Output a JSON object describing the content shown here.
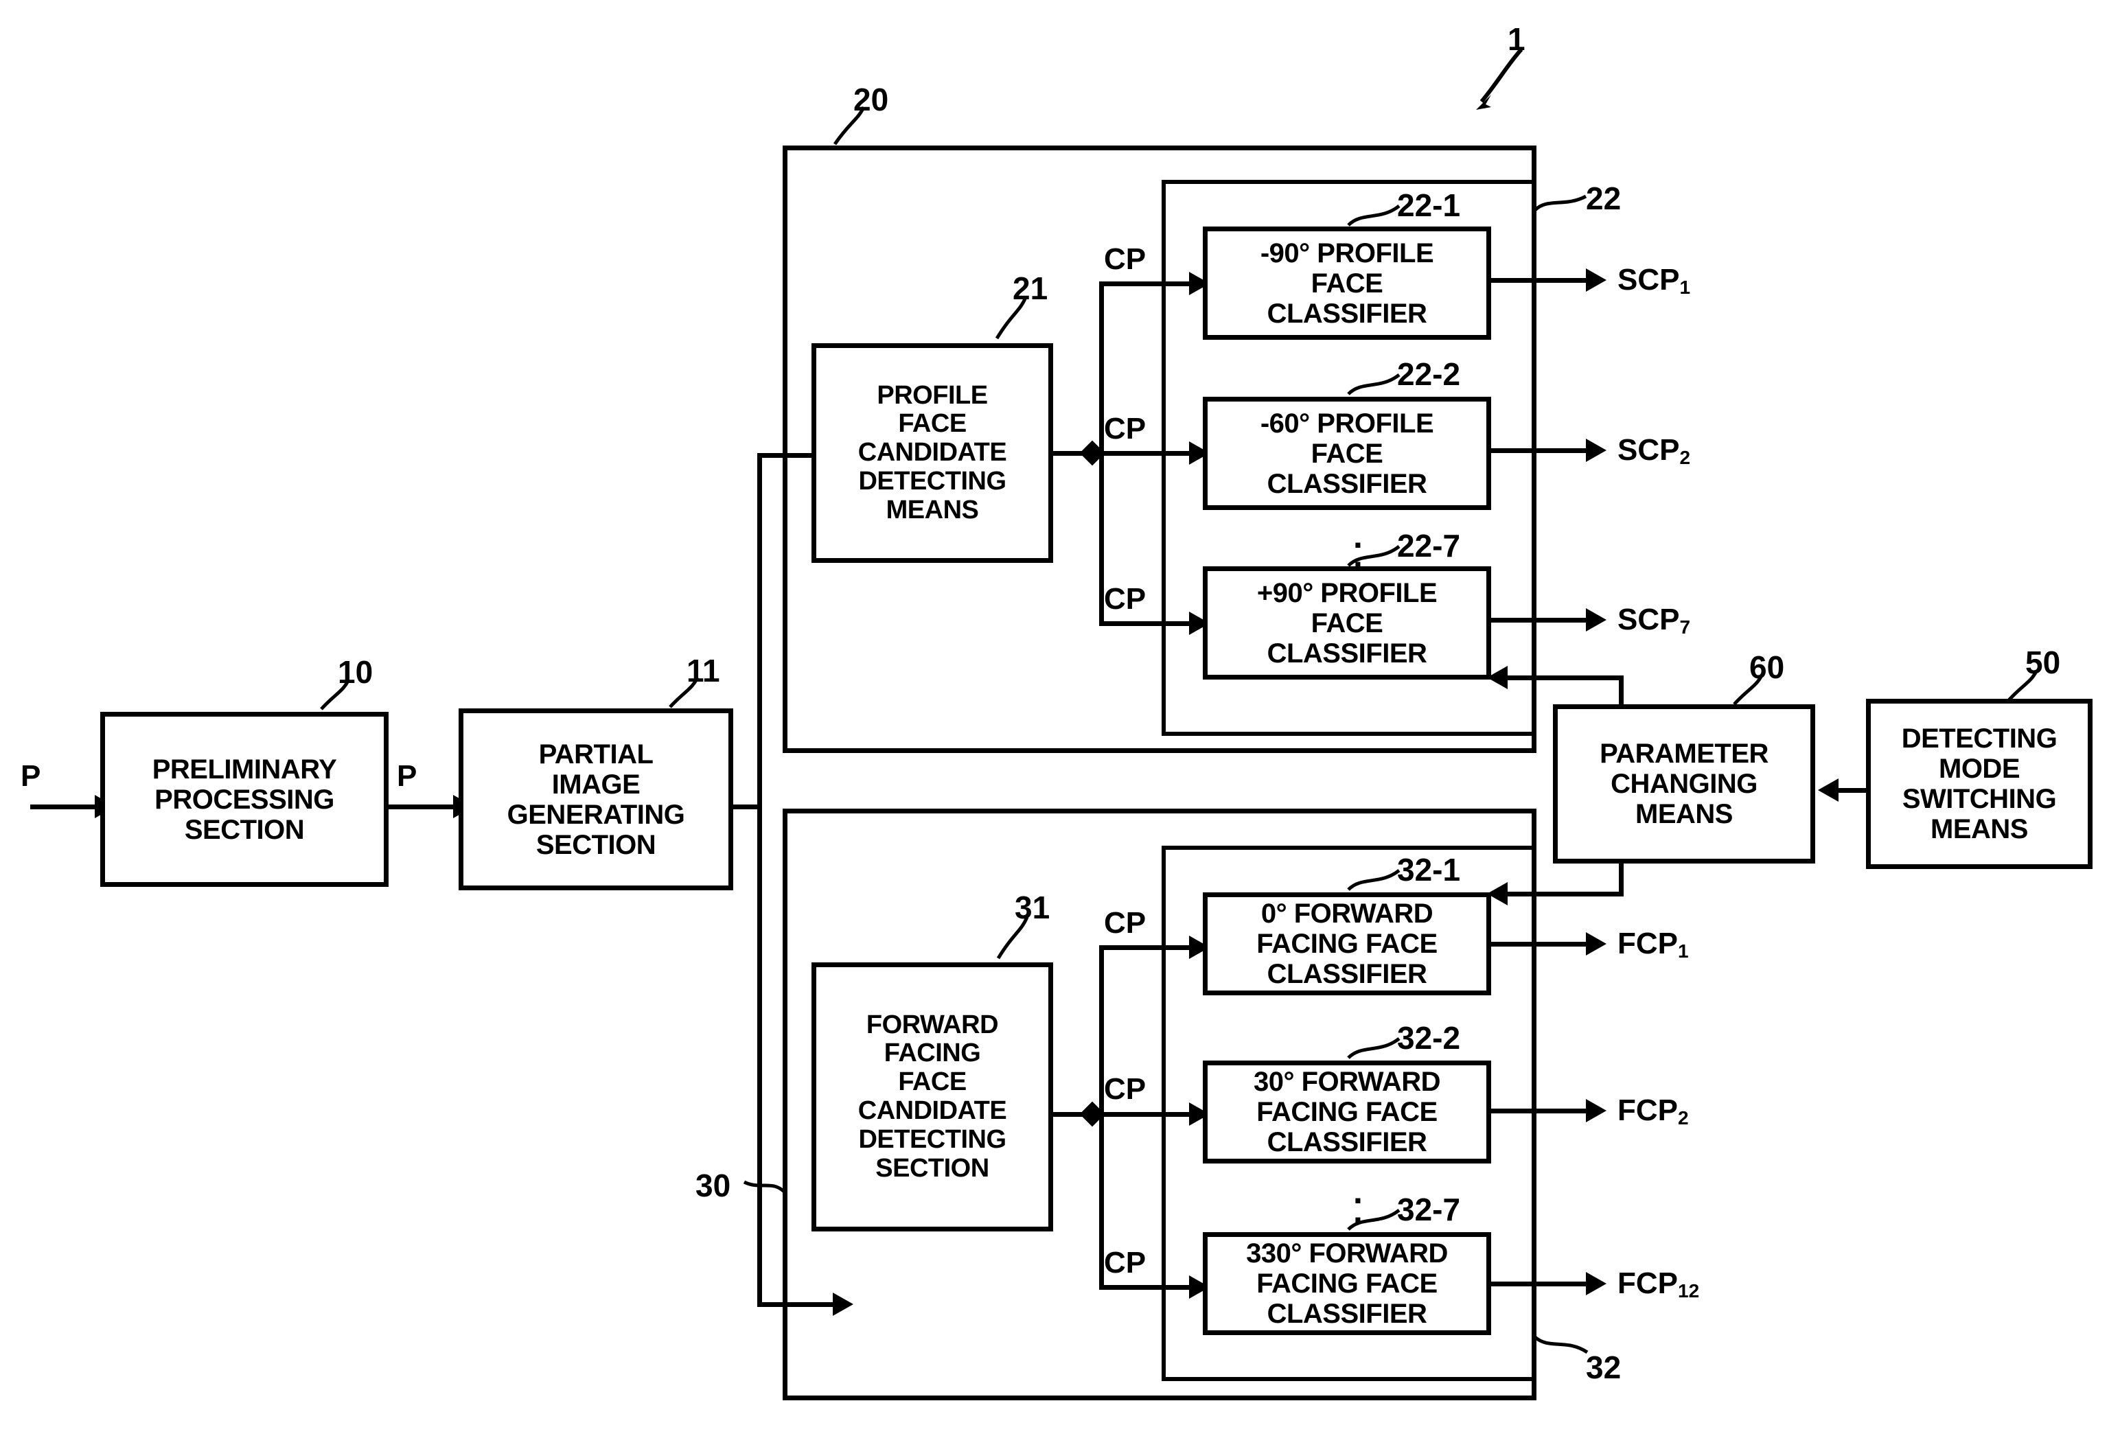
{
  "figure": {
    "system_reference": "1",
    "input_signal": "P",
    "intermediate_signal": "P",
    "candidate_signal": "CP"
  },
  "blocks": {
    "preliminary": {
      "ref": "10",
      "lines": [
        "PRELIMINARY",
        "PROCESSING",
        "SECTION"
      ]
    },
    "partial_image": {
      "ref": "11",
      "lines": [
        "PARTIAL",
        "IMAGE",
        "GENERATING",
        "SECTION"
      ]
    },
    "profile_section": {
      "ref": "20"
    },
    "profile_candidate": {
      "ref": "21",
      "lines": [
        "PROFILE",
        "FACE",
        "CANDIDATE",
        "DETECTING",
        "MEANS"
      ]
    },
    "profile_classifier_group": {
      "ref": "22"
    },
    "forward_section": {
      "ref": "30"
    },
    "forward_candidate": {
      "ref": "31",
      "lines": [
        "FORWARD",
        "FACING",
        "FACE",
        "CANDIDATE",
        "DETECTING",
        "SECTION"
      ]
    },
    "forward_classifier_group": {
      "ref": "32"
    },
    "parameter_changing": {
      "ref": "60",
      "lines": [
        "PARAMETER",
        "CHANGING",
        "MEANS"
      ]
    },
    "detecting_mode_switching": {
      "ref": "50",
      "lines": [
        "DETECTING",
        "MODE",
        "SWITCHING",
        "MEANS"
      ]
    }
  },
  "profile_classifiers": [
    {
      "ref": "22-1",
      "lines": [
        "-90° PROFILE",
        "FACE",
        "CLASSIFIER"
      ],
      "input": "CP",
      "output": "SCP",
      "output_sub": "1"
    },
    {
      "ref": "22-2",
      "lines": [
        "-60° PROFILE",
        "FACE",
        "CLASSIFIER"
      ],
      "input": "CP",
      "output": "SCP",
      "output_sub": "2"
    },
    {
      "ref": "22-7",
      "lines": [
        "+90° PROFILE",
        "FACE",
        "CLASSIFIER"
      ],
      "input": "CP",
      "output": "SCP",
      "output_sub": "7"
    }
  ],
  "forward_classifiers": [
    {
      "ref": "32-1",
      "lines": [
        "0° FORWARD",
        "FACING FACE",
        "CLASSIFIER"
      ],
      "input": "CP",
      "output": "FCP",
      "output_sub": "1"
    },
    {
      "ref": "32-2",
      "lines": [
        "30° FORWARD",
        "FACING FACE",
        "CLASSIFIER"
      ],
      "input": "CP",
      "output": "FCP",
      "output_sub": "2"
    },
    {
      "ref": "32-7",
      "lines": [
        "330° FORWARD",
        "FACING FACE",
        "CLASSIFIER"
      ],
      "input": "CP",
      "output": "FCP",
      "output_sub": "12"
    }
  ],
  "ellipsis": "⋮"
}
